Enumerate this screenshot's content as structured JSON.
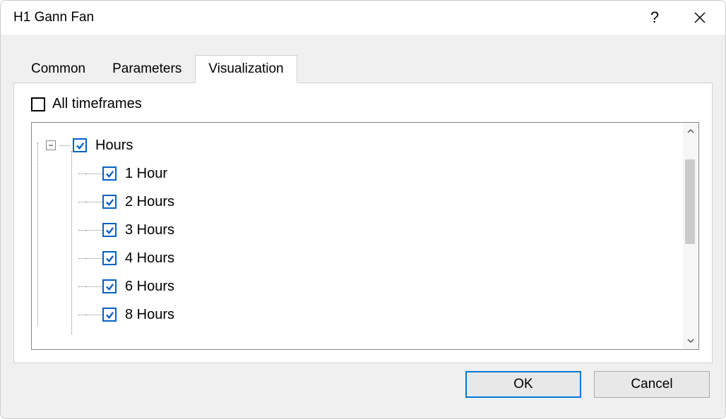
{
  "title": "H1 Gann Fan",
  "tabs": {
    "common": "Common",
    "parameters": "Parameters",
    "visualization": "Visualization"
  },
  "all_timeframes_label": "All timeframes",
  "tree": {
    "parent": "Hours",
    "children": [
      "1 Hour",
      "2 Hours",
      "3 Hours",
      "4 Hours",
      "6 Hours",
      "8 Hours"
    ]
  },
  "buttons": {
    "ok": "OK",
    "cancel": "Cancel"
  },
  "expander_glyph": "−",
  "help_glyph": "?"
}
